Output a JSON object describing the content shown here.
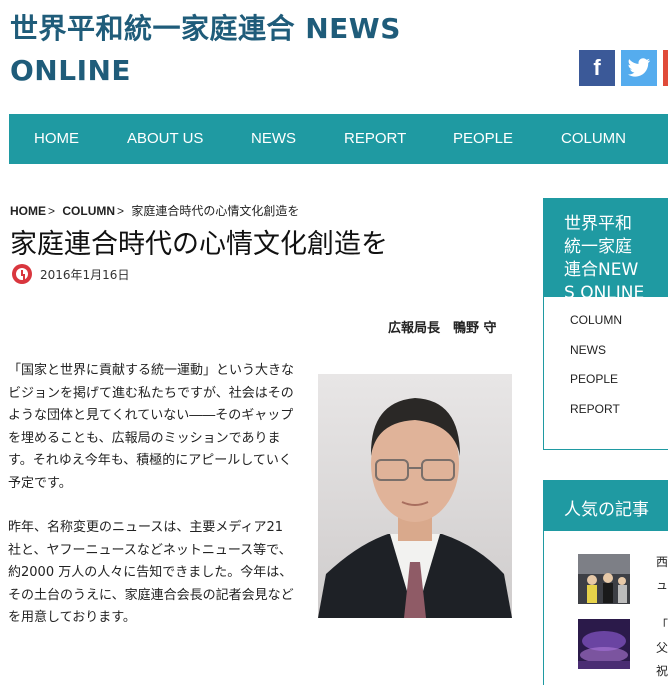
{
  "header": {
    "title_line1": "世界平和統一家庭連合 NEWS",
    "title_line2": "ONLINE",
    "social": [
      "facebook-icon",
      "twitter-icon"
    ]
  },
  "nav": [
    "HOME",
    "ABOUT US",
    "NEWS",
    "REPORT",
    "PEOPLE",
    "COLUMN"
  ],
  "breadcrumb": {
    "home": "HOME",
    "column": "COLUMN",
    "current": "家庭連合時代の心情文化創造を",
    "separator": ">"
  },
  "article": {
    "title": "家庭連合時代の心情文化創造を",
    "date": "2016年1月16日",
    "author": "広報局長　鴨野 守",
    "para1": "「国家と世界に貢献する統一運動」という大きなビジョンを掲げて進む私たちですが、社会はそのような団体と見てくれていない――そのギャップを埋めることも、広報局のミッションであります。それゆえ今年も、積極的にアピールしていく予定です。",
    "para2": "昨年、名称変更のニュースは、主要メディア21 社と、ヤフーニュースなどネットニュース等で、約2000 万人の人々に告知できました。今年は、その土台のうえに、家庭連合会長の記者会見などを用意しております。"
  },
  "sidebar": {
    "category_title": "世界平和統一家庭連合NEWS ONLINEカテゴリ",
    "categories": [
      "COLUMN",
      "NEWS",
      "PEOPLE",
      "REPORT"
    ],
    "popular_title": "人気の記事",
    "popular_items": [
      {
        "text": "西\nュ"
      },
      {
        "text": "「\n父\n祝"
      }
    ]
  },
  "colors": {
    "accent": "#1f9aa2",
    "title": "#1f5c7a",
    "facebook": "#3b5998",
    "twitter": "#55acee"
  }
}
